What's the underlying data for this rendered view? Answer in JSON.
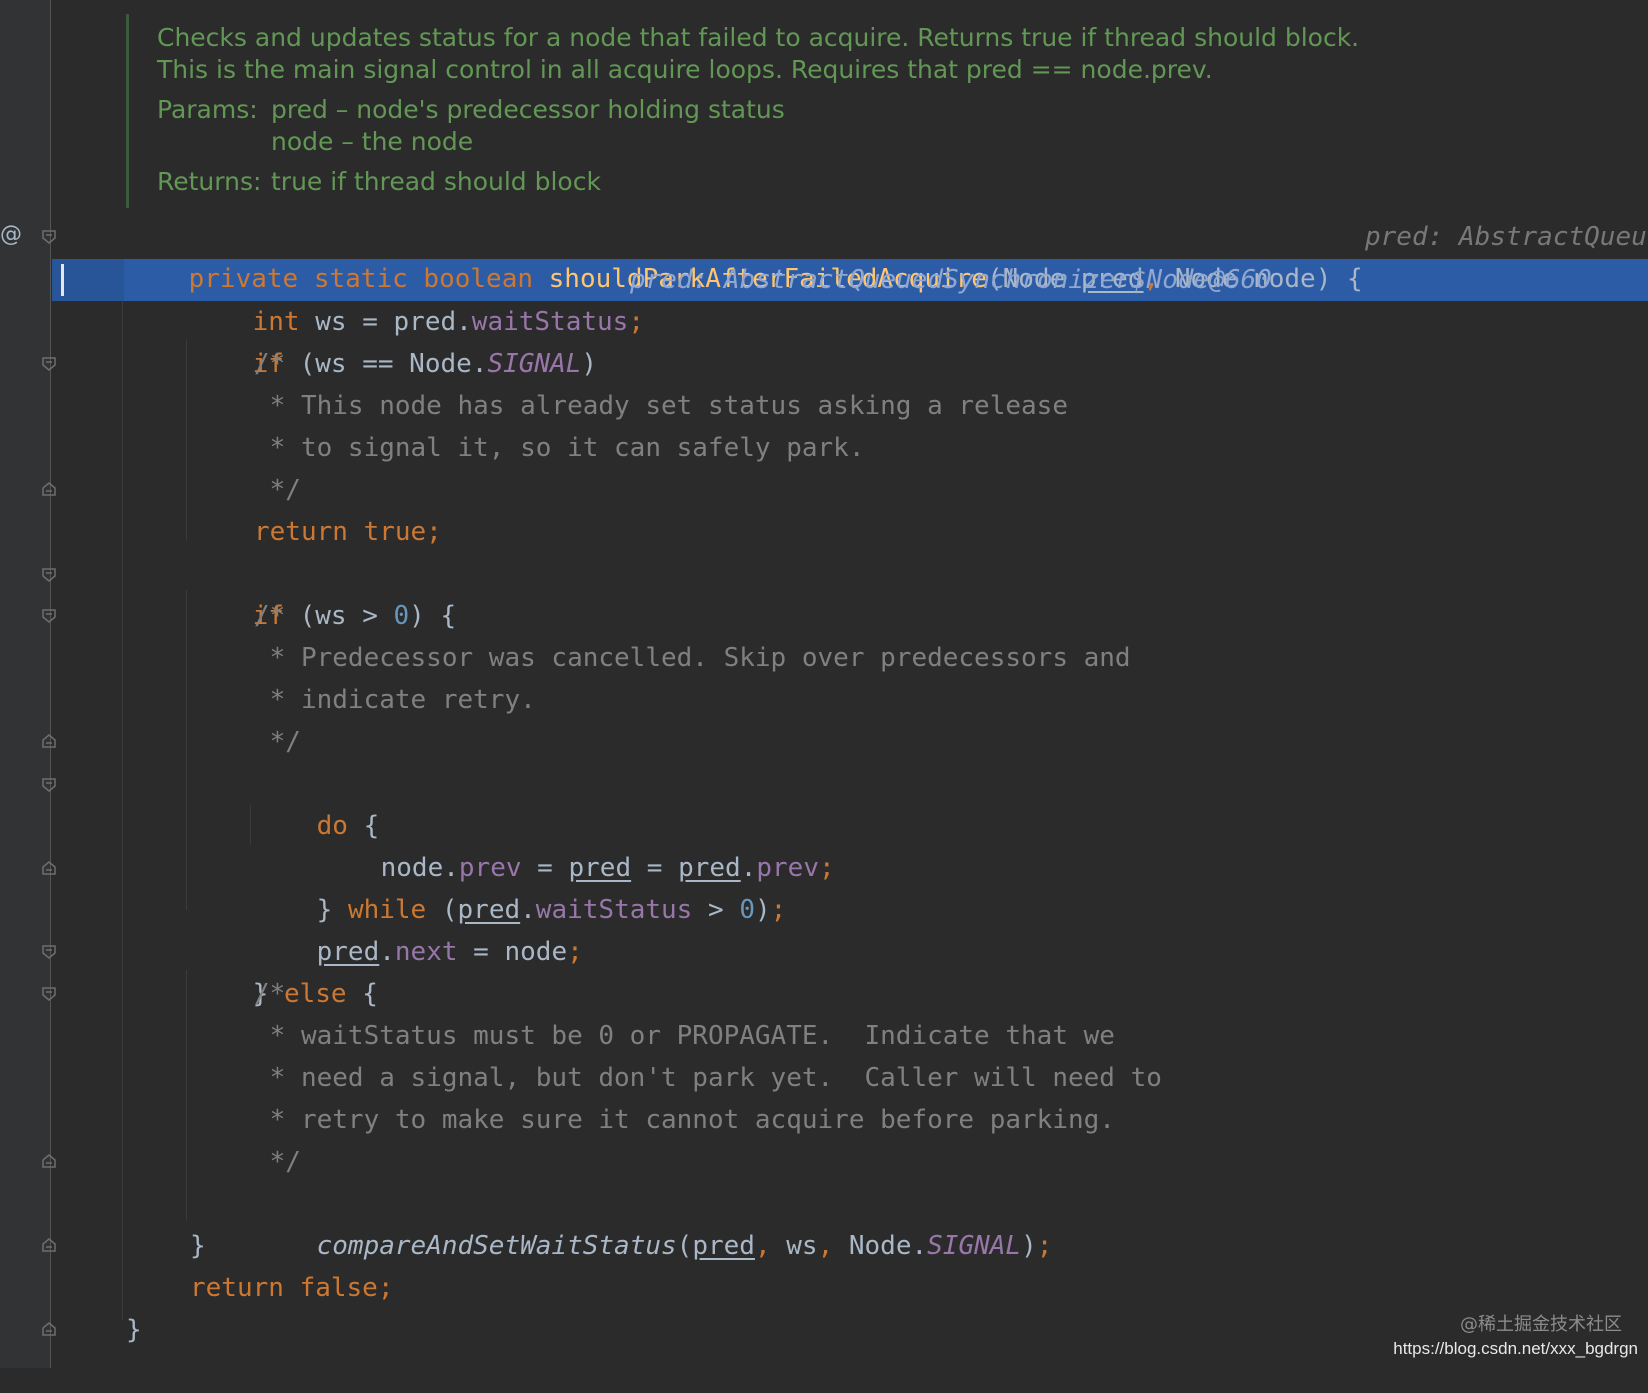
{
  "doc": {
    "line1": "Checks and updates status for a node that failed to acquire. Returns true if thread should block.",
    "line2": "This is the main signal control in all acquire loops. Requires that pred == node.prev.",
    "params_label": "Params:",
    "param1": "pred – node's predecessor holding status",
    "param2": "node – the node",
    "returns_label": "Returns:",
    "returns_text": "true if thread should block"
  },
  "gutter": {
    "override_marker": "@"
  },
  "code": {
    "l1": {
      "t1": "private static boolean ",
      "t2": "shouldParkAfterFailedAcquire",
      "t3": "(Node ",
      "t4": "pred",
      "t5": ", ",
      "t6": "Node node) {",
      "hint": "pred: AbstractQueu"
    },
    "l2": {
      "t1": "int ",
      "t2": "ws = pred.",
      "t3": "waitStatus",
      "t4": ";",
      "hint": "pred: AbstractQueuedSynchronizer$Node@660"
    },
    "l3": {
      "t1": "if ",
      "t2": "(ws == Node.",
      "t3": "SIGNAL",
      "t4": ")"
    },
    "c1": {
      "a": "/*",
      "b": " * This node has already set status asking a release",
      "c": " * to signal it, so it can safely park.",
      "d": " */"
    },
    "l4": {
      "t1": "return true;"
    },
    "l5": {
      "t1": "if ",
      "t2": "(ws > ",
      "t3": "0",
      "t4": ") {"
    },
    "c2": {
      "a": "/*",
      "b": " * Predecessor was cancelled. Skip over predecessors and",
      "c": " * indicate retry.",
      "d": " */"
    },
    "l6": {
      "t1": "do ",
      "t2": "{"
    },
    "l7": {
      "t1": "node.",
      "t2": "prev",
      "t3": " = ",
      "t4": "pred",
      "t5": " = ",
      "t6": "pred",
      "t7": ".",
      "t8": "prev",
      "t9": ";"
    },
    "l8": {
      "t1": "} ",
      "t2": "while ",
      "t3": "(",
      "t4": "pred",
      "t5": ".",
      "t6": "waitStatus",
      "t7": " > ",
      "t8": "0",
      "t9": ")",
      "t10": ";"
    },
    "l9": {
      "t1": "pred",
      "t2": ".",
      "t3": "next",
      "t4": " = node",
      "t5": ";"
    },
    "l10": {
      "t1": "} ",
      "t2": "else ",
      "t3": "{"
    },
    "c3": {
      "a": "/*",
      "b": " * waitStatus must be 0 or PROPAGATE.  Indicate that we",
      "c": " * need a signal, but don't park yet.  Caller will need to",
      "d": " * retry to make sure it cannot acquire before parking.",
      "e": " */"
    },
    "l11": {
      "t1": "compareAndSetWaitStatus",
      "t2": "(",
      "t3": "pred",
      "t4": ", ",
      "t5": "ws",
      "t6": ", ",
      "t7": "Node.",
      "t8": "SIGNAL",
      "t9": ")",
      "t10": ";"
    },
    "l12": {
      "t1": "}"
    },
    "l13": {
      "t1": "return false;"
    },
    "l14": {
      "t1": "}"
    }
  },
  "watermark": {
    "site": "@稀土掘金技术社区",
    "url": "https://blog.csdn.net/xxx_bgdrgn"
  },
  "colors": {
    "background": "#2b2b2b",
    "gutter": "#313335",
    "selection": "#2d5ca6",
    "keyword": "#cc7832",
    "function": "#ffc66d",
    "identifier": "#a9b7c6",
    "field": "#9876aa",
    "number": "#6897bb",
    "comment": "#808080",
    "doc": "#629755"
  }
}
